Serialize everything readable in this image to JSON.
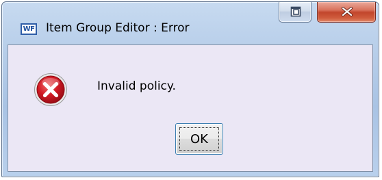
{
  "window": {
    "app_icon_text": "WF",
    "title": "Item Group Editor : Error"
  },
  "dialog": {
    "icon": "error-icon",
    "message": "Invalid policy.",
    "ok_label": "OK"
  },
  "colors": {
    "titlebar": "#b6cde9",
    "client_background": "#ebe7f5",
    "close_button": "#c2462c",
    "error_icon": "#c8102e"
  }
}
